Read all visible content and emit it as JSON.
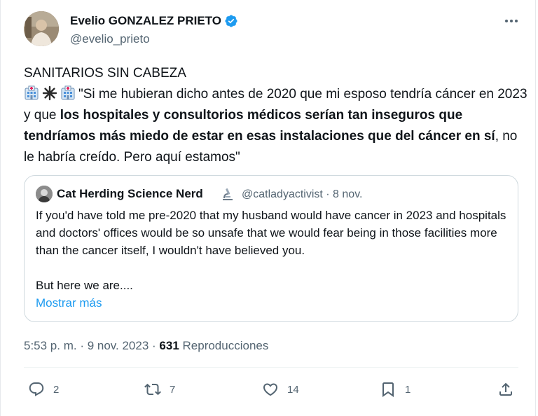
{
  "author": {
    "display_name": "Evelio GONZALEZ PRIETO",
    "handle": "@evelio_prieto",
    "verified_icon": "verified-badge-icon",
    "accent_color": "#1d9bf0"
  },
  "tweet": {
    "headline": "SANITARIOS SIN CABEZA",
    "emoji_sequence": [
      "hospital-emoji",
      "sparkle-emoji",
      "hospital-emoji"
    ],
    "text_part1": "\"Si me hubieran dicho antes de 2020 que mi esposo tendría cáncer en 2023 y que ",
    "text_bold": "los hospitales y consultorios médicos serían tan inseguros que tendríamos más miedo de estar en esas instalaciones que del cáncer en sí",
    "text_part2": ", no le habría creído. Pero aquí estamos\""
  },
  "quote": {
    "display_name": "Cat Herding Science Nerd",
    "name_emoji": "microscope-emoji",
    "handle_date": "@catladyactivist · 8 nov.",
    "text_paragraph1": "If you'd have told me pre-2020 that my husband would have cancer in 2023 and hospitals and doctors' offices would be so unsafe that we would fear being in those facilities more than the cancer itself, I wouldn't have believed you.",
    "text_paragraph2": "But here we are....",
    "show_more": "Mostrar más"
  },
  "meta": {
    "timestamp": "5:53 p. m. · 9 nov. 2023 · ",
    "views_count": "631",
    "views_label": " Reproducciones"
  },
  "actions": {
    "replies": "2",
    "retweets": "7",
    "likes": "14",
    "bookmarks": "1"
  }
}
